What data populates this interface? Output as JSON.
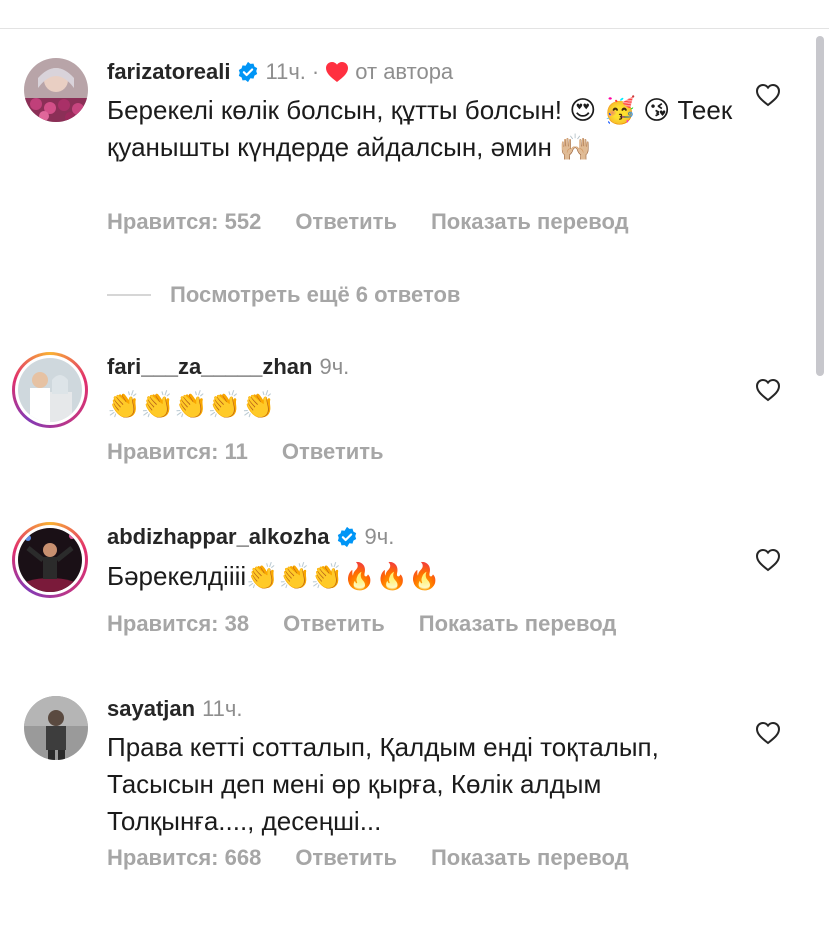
{
  "comments": [
    {
      "username": "farizatoreali",
      "verified": true,
      "time": "11ч.",
      "separator": "·",
      "author_liked_label": "от автора",
      "text": "Берекелі көлік болсын, құтты болсын! 😍 🥳 😘 Теек қуанышты күндерде айдалсын, әмин 🙌🏼",
      "likes": "Нравится: 552",
      "reply": "Ответить",
      "translate": "Показать перевод"
    },
    {
      "username": "fari___za_____zhan",
      "verified": false,
      "time": "9ч.",
      "text": "👏👏👏👏👏",
      "likes": "Нравится: 11",
      "reply": "Ответить"
    },
    {
      "username": "abdizhappar_alkozha",
      "verified": true,
      "time": "9ч.",
      "text": "Бәрекелдіііі👏👏👏🔥🔥🔥",
      "likes": "Нравится: 38",
      "reply": "Ответить",
      "translate": "Показать перевод"
    },
    {
      "username": "sayatjan",
      "verified": false,
      "time": "11ч.",
      "text": "Права кетті сотталып, Қалдым енді тоқталып, Тасысын деп мені өр қырға, Көлік алдым Толқынға...., десеңші...",
      "likes": "Нравится: 668",
      "reply": "Ответить",
      "translate": "Показать перевод"
    }
  ],
  "more_replies_label": "Посмотреть ещё 6 ответов",
  "colors": {
    "verified": "#0095f6",
    "author_heart": "#ff3040",
    "muted": "#8e8e8e"
  },
  "icons": [
    "verified-badge-icon",
    "author-heart-icon",
    "like-heart-icon",
    "avatar-image"
  ]
}
